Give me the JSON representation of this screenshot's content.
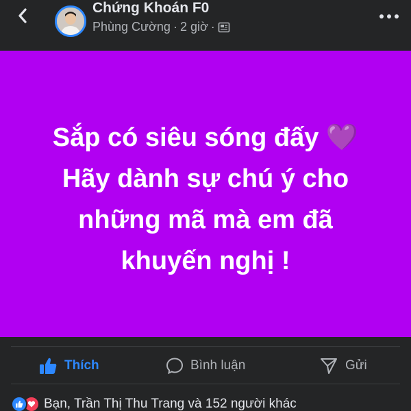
{
  "header": {
    "group_name": "Chứng Khoán F0",
    "author": "Phùng Cường",
    "separator": "·",
    "time": "2 giờ"
  },
  "post": {
    "lines": [
      "Sắp có siêu sóng đấy 💜",
      "Hãy dành sự chú ý cho",
      "những mã mà em đã",
      "khuyến nghị !"
    ],
    "background_color": "#b100f2"
  },
  "actions": {
    "like": "Thích",
    "comment": "Bình luận",
    "share": "Gửi"
  },
  "reactions": {
    "summary": "Bạn, Trần Thị Thu Trang và 152 người khác"
  },
  "colors": {
    "accent": "#2d88ff",
    "love": "#f33e58",
    "surface": "#242526"
  }
}
